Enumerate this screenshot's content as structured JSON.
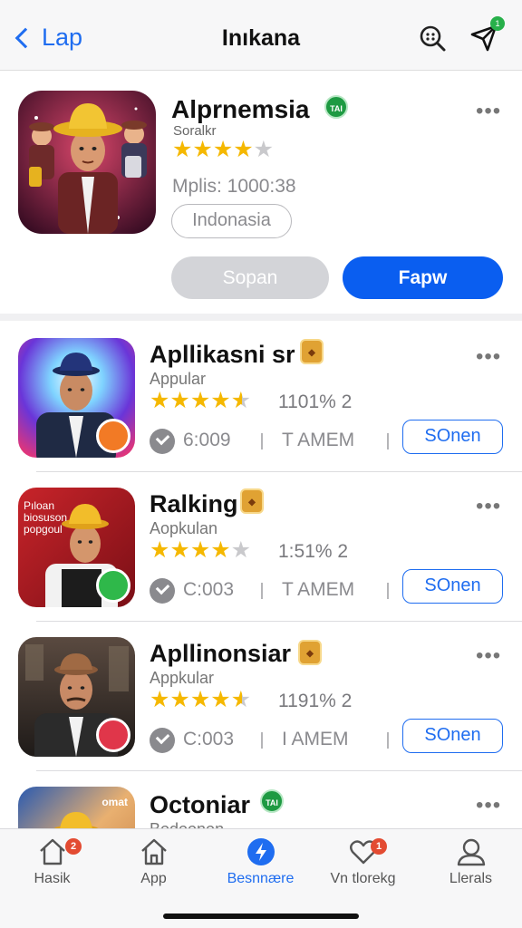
{
  "header": {
    "back_label": "Lap",
    "title": "Inıkana"
  },
  "featured": {
    "name": "Alprnemsia",
    "badge": "TAI",
    "subtitle": "Soralkr",
    "rating_stars": 4,
    "meta": "Mplis: 1000:38",
    "country": "Indonasia",
    "secondary_button": "Sopan",
    "primary_button": "Fapw"
  },
  "apps": [
    {
      "name": "Apllikasni sr",
      "subtitle": "Appular",
      "rating": "1101% 2",
      "stars": 4.5,
      "code": "6:009",
      "tag": "T AMEM",
      "button": "SOnen",
      "badge_color": "#f27a25"
    },
    {
      "name": "Ralking",
      "subtitle": "Aopkulan",
      "rating": "1:51% 2",
      "stars": 4,
      "code": "C:003",
      "tag": "T AMEM",
      "button": "SOnen",
      "badge_color": "#2fb84a",
      "poster_text": "Pıloan\nbiosuson\npopgoul"
    },
    {
      "name": "Apllinonsiar",
      "subtitle": "Appkular",
      "rating": "1191% 2",
      "stars": 4.5,
      "code": "C:003",
      "tag": "I AMEM",
      "button": "SOnen",
      "badge_color": "#e0364a"
    },
    {
      "name": "Octoniar",
      "subtitle": "Bodoonon",
      "poster_text": "omat"
    }
  ],
  "tabs": [
    {
      "label": "Hasik",
      "badge": "2"
    },
    {
      "label": "App"
    },
    {
      "label": "Besnnære"
    },
    {
      "label": "Vn tlorekg",
      "badge": "1"
    },
    {
      "label": "Llerals"
    }
  ],
  "notification_count": "1",
  "colors": {
    "accent": "#0a5ef0",
    "star": "#f5b800"
  }
}
